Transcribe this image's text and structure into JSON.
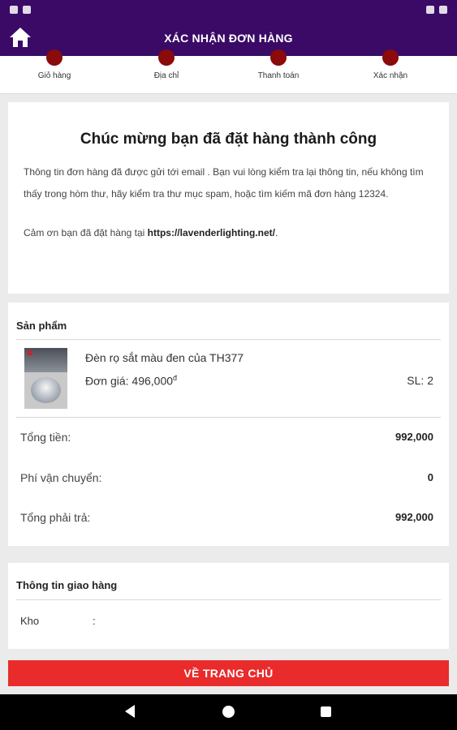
{
  "appbar": {
    "title": "XÁC NHẬN ĐƠN HÀNG"
  },
  "steps": [
    {
      "label": "Giỏ hàng"
    },
    {
      "label": "Địa chỉ"
    },
    {
      "label": "Thanh toán"
    },
    {
      "label": "Xác nhận"
    }
  ],
  "success": {
    "heading": "Chúc mừng bạn đã đặt hàng thành công",
    "message": "Thông tin đơn hàng đã được gửi tới email . Bạn vui lòng kiểm tra lại thông tin, nếu không tìm thấy trong hòm thư, hãy kiểm tra thư mục spam, hoặc tìm kiếm mã đơn hàng 12324.",
    "thanks_prefix": "Cảm ơn bạn đã đặt hàng tại ",
    "thanks_link": "https://lavenderlighting.net/",
    "thanks_suffix": "."
  },
  "products": {
    "heading": "Sản phẩm",
    "item": {
      "name": "Đèn rọ sắt màu đen của TH377",
      "price_label": "Đơn giá: 496,000",
      "currency": "đ",
      "qty": "SL: 2"
    },
    "summary": [
      {
        "label": "Tổng tiền:",
        "value": "992,000"
      },
      {
        "label": "Phí vận chuyển:",
        "value": "0"
      },
      {
        "label": "Tổng phải trả:",
        "value": "992,000"
      }
    ]
  },
  "shipping": {
    "heading": "Thông tin giao hàng",
    "rows": [
      {
        "label": "Kho",
        "sep": ":"
      }
    ]
  },
  "footer": {
    "button_label": "VỀ TRANG CHỦ"
  },
  "colors": {
    "primary": "#3a0a66",
    "step_dot": "#8b0a0a",
    "button": "#e92b2b"
  },
  "icons": {
    "home": "home-icon",
    "back": "nav-back-icon",
    "home_nav": "nav-home-icon",
    "recent": "nav-recent-icon"
  }
}
